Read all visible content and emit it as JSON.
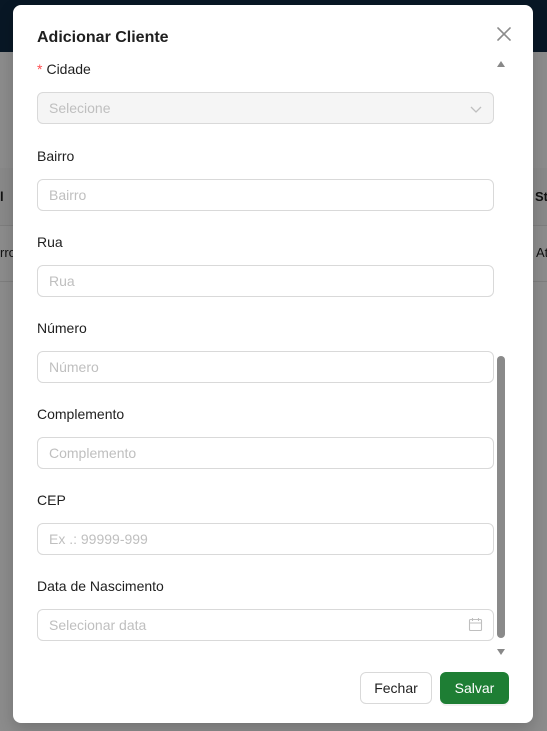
{
  "background": {
    "cells": [
      "l",
      "St",
      "rro",
      "At"
    ]
  },
  "modal": {
    "title": "Adicionar Cliente",
    "fields": [
      {
        "label": "Cidade",
        "required": true,
        "type": "select",
        "placeholder": "Selecione",
        "disabled": true
      },
      {
        "label": "Bairro",
        "placeholder": "Bairro"
      },
      {
        "label": "Rua",
        "placeholder": "Rua"
      },
      {
        "label": "Número",
        "placeholder": "Número"
      },
      {
        "label": "Complemento",
        "placeholder": "Complemento"
      },
      {
        "label": "CEP",
        "placeholder": "Ex .: 99999-999"
      },
      {
        "label": "Data de Nascimento",
        "placeholder": "Selecionar data",
        "icon": "calendar-icon"
      }
    ],
    "required_mark": "*",
    "buttons": {
      "close_label": "Fechar",
      "save_label": "Salvar"
    }
  },
  "colors": {
    "primary": "#1e7e34",
    "required": "#ff4d4f",
    "topbar": "#0f2a44"
  }
}
